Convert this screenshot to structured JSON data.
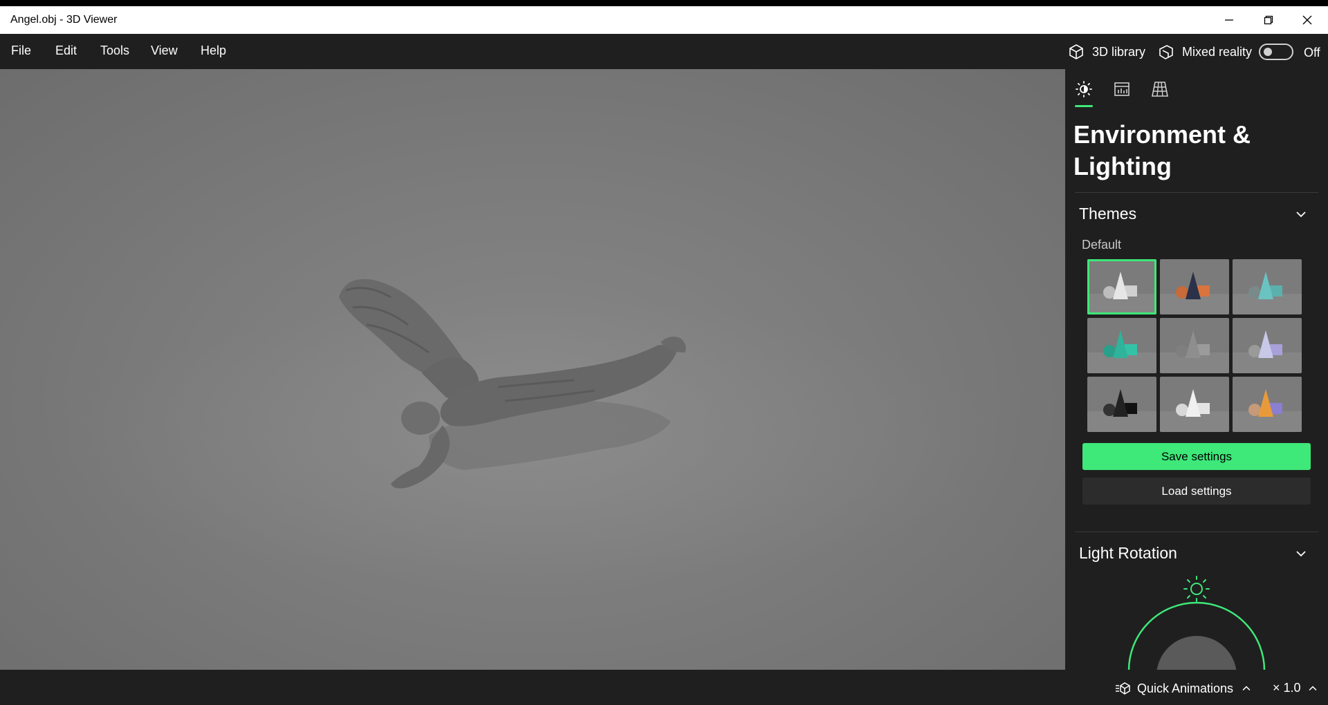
{
  "window": {
    "title": "Angel.obj - 3D Viewer"
  },
  "menu": {
    "file": "File",
    "edit": "Edit",
    "tools": "Tools",
    "view": "View",
    "help": "Help"
  },
  "topbar": {
    "library_label": "3D library",
    "mixed_reality_label": "Mixed reality",
    "mixed_reality_state": "Off"
  },
  "panel": {
    "title": "Environment & Lighting",
    "themes": {
      "header": "Themes",
      "group_label": "Default",
      "selected_index": 0,
      "items": [
        {
          "name": "white",
          "colors": [
            "#e6e6e6",
            "#d0d0d0",
            "#bdbdbd"
          ]
        },
        {
          "name": "orange-navy",
          "colors": [
            "#2a3148",
            "#d9743f",
            "#c86a3a"
          ]
        },
        {
          "name": "teal",
          "colors": [
            "#6ac3c0",
            "#5bb0ad",
            "#7a8a8a"
          ]
        },
        {
          "name": "green",
          "colors": [
            "#2fb39a",
            "#34c2a6",
            "#2a9f89"
          ]
        },
        {
          "name": "gray",
          "colors": [
            "#8e8e8e",
            "#9b9b9b",
            "#7f7f7f"
          ]
        },
        {
          "name": "lavender",
          "colors": [
            "#c8c8e8",
            "#a8a0d8",
            "#9a9a9a"
          ]
        },
        {
          "name": "black",
          "colors": [
            "#222222",
            "#111111",
            "#333333"
          ]
        },
        {
          "name": "light",
          "colors": [
            "#f0f0f0",
            "#e4e4e4",
            "#d8d8d8"
          ]
        },
        {
          "name": "purple-orange",
          "colors": [
            "#e89a3a",
            "#8a7fd0",
            "#c69a78"
          ]
        }
      ]
    },
    "save_label": "Save settings",
    "load_label": "Load settings",
    "light_rotation": {
      "header": "Light Rotation"
    }
  },
  "status": {
    "quick_animations": "Quick Animations",
    "speed": "× 1.0"
  },
  "colors": {
    "accent": "#3ee879",
    "chrome": "#1f1f1f",
    "viewport": "#7c7c7c"
  }
}
